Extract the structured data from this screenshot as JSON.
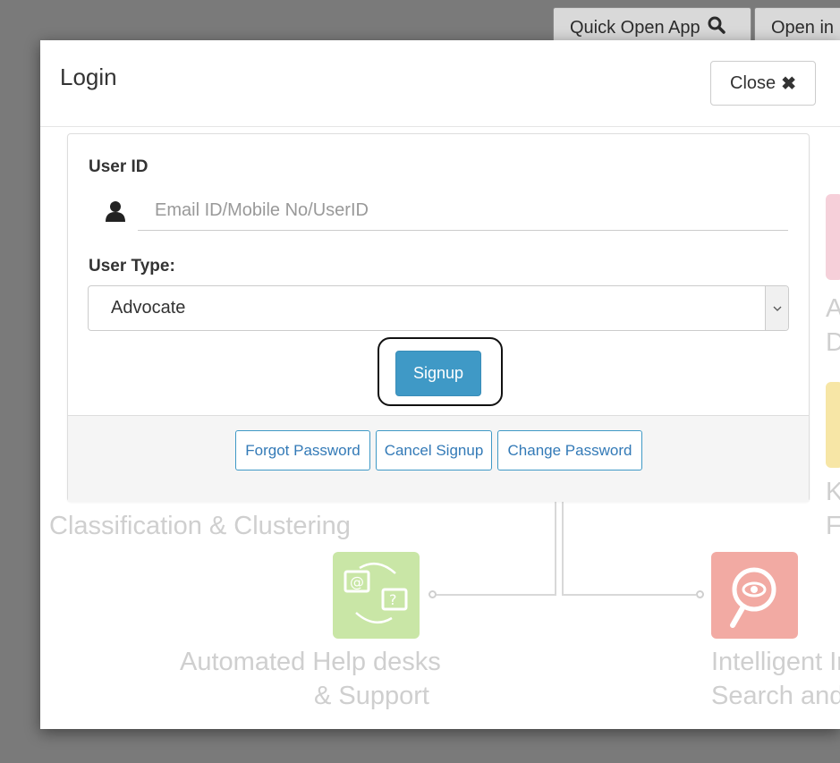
{
  "topbar": {
    "quick_open_label": "Quick Open App",
    "open_in_label": "Open in"
  },
  "modal": {
    "title": "Login",
    "close_label": "Close"
  },
  "form": {
    "user_id_label": "User ID",
    "user_id_placeholder": "Email ID/Mobile No/UserID",
    "user_type_label": "User Type:",
    "user_type_value": "Advocate",
    "signup_label": "Signup"
  },
  "footer": {
    "forgot_password": "Forgot Password",
    "cancel_signup": "Cancel Signup",
    "change_password": "Change Password"
  },
  "background": {
    "classification_text": "Classification & Clustering",
    "helpdesk_line1": "Automated Help desks",
    "helpdesk_line2": "& Support",
    "search_line1": "Intelligent In",
    "search_line2": "Search and",
    "right_fragment_1": "A",
    "right_fragment_2": "D",
    "right_fragment_3": "K",
    "right_fragment_4": "F"
  },
  "colors": {
    "primary": "#3f99c6",
    "link": "#337ab7",
    "helpdesk_icon": "#c9e6a6",
    "search_icon": "#f2aaa3"
  },
  "icons": {
    "search": "search-icon",
    "close": "close-icon",
    "user": "user-icon",
    "dropdown": "chevron-down-icon"
  }
}
